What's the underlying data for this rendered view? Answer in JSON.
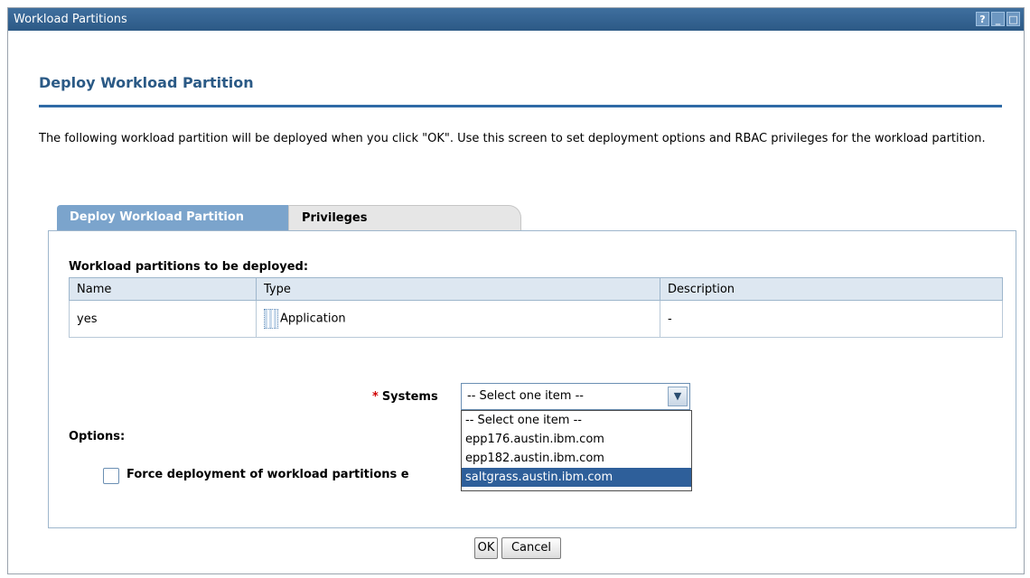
{
  "window": {
    "title": "Workload Partitions",
    "controls": [
      "?",
      "_",
      "□"
    ]
  },
  "page": {
    "heading": "Deploy Workload Partition",
    "description": "The following workload partition will be deployed when you click \"OK\". Use this screen to set deployment options and RBAC privileges for the workload partition."
  },
  "tabs": [
    {
      "label": "Deploy Workload Partition",
      "active": true
    },
    {
      "label": "Privileges",
      "active": false
    }
  ],
  "table": {
    "title": "Workload partitions to be deployed:",
    "columns": [
      "Name",
      "Type",
      "Description"
    ],
    "rows": [
      {
        "name": "yes",
        "type": "Application",
        "type_icon": "application-icon",
        "description": "-"
      }
    ]
  },
  "systems": {
    "required_marker": "*",
    "label": "Systems",
    "selected": "-- Select one item --",
    "options": [
      "-- Select one item --",
      "epp176.austin.ibm.com",
      "epp182.austin.ibm.com",
      "saltgrass.austin.ibm.com"
    ],
    "highlighted_index": 3
  },
  "options": {
    "label": "Options:",
    "force_label": "Force deployment of workload partitions e",
    "force_checked": false
  },
  "buttons": {
    "ok": "OK",
    "cancel": "Cancel"
  },
  "colors": {
    "titlebar": "#2c5986",
    "accent": "#2e6aa6",
    "active_tab": "#7ba4cc",
    "required": "#d00000",
    "selection": "#2e5f9a"
  }
}
